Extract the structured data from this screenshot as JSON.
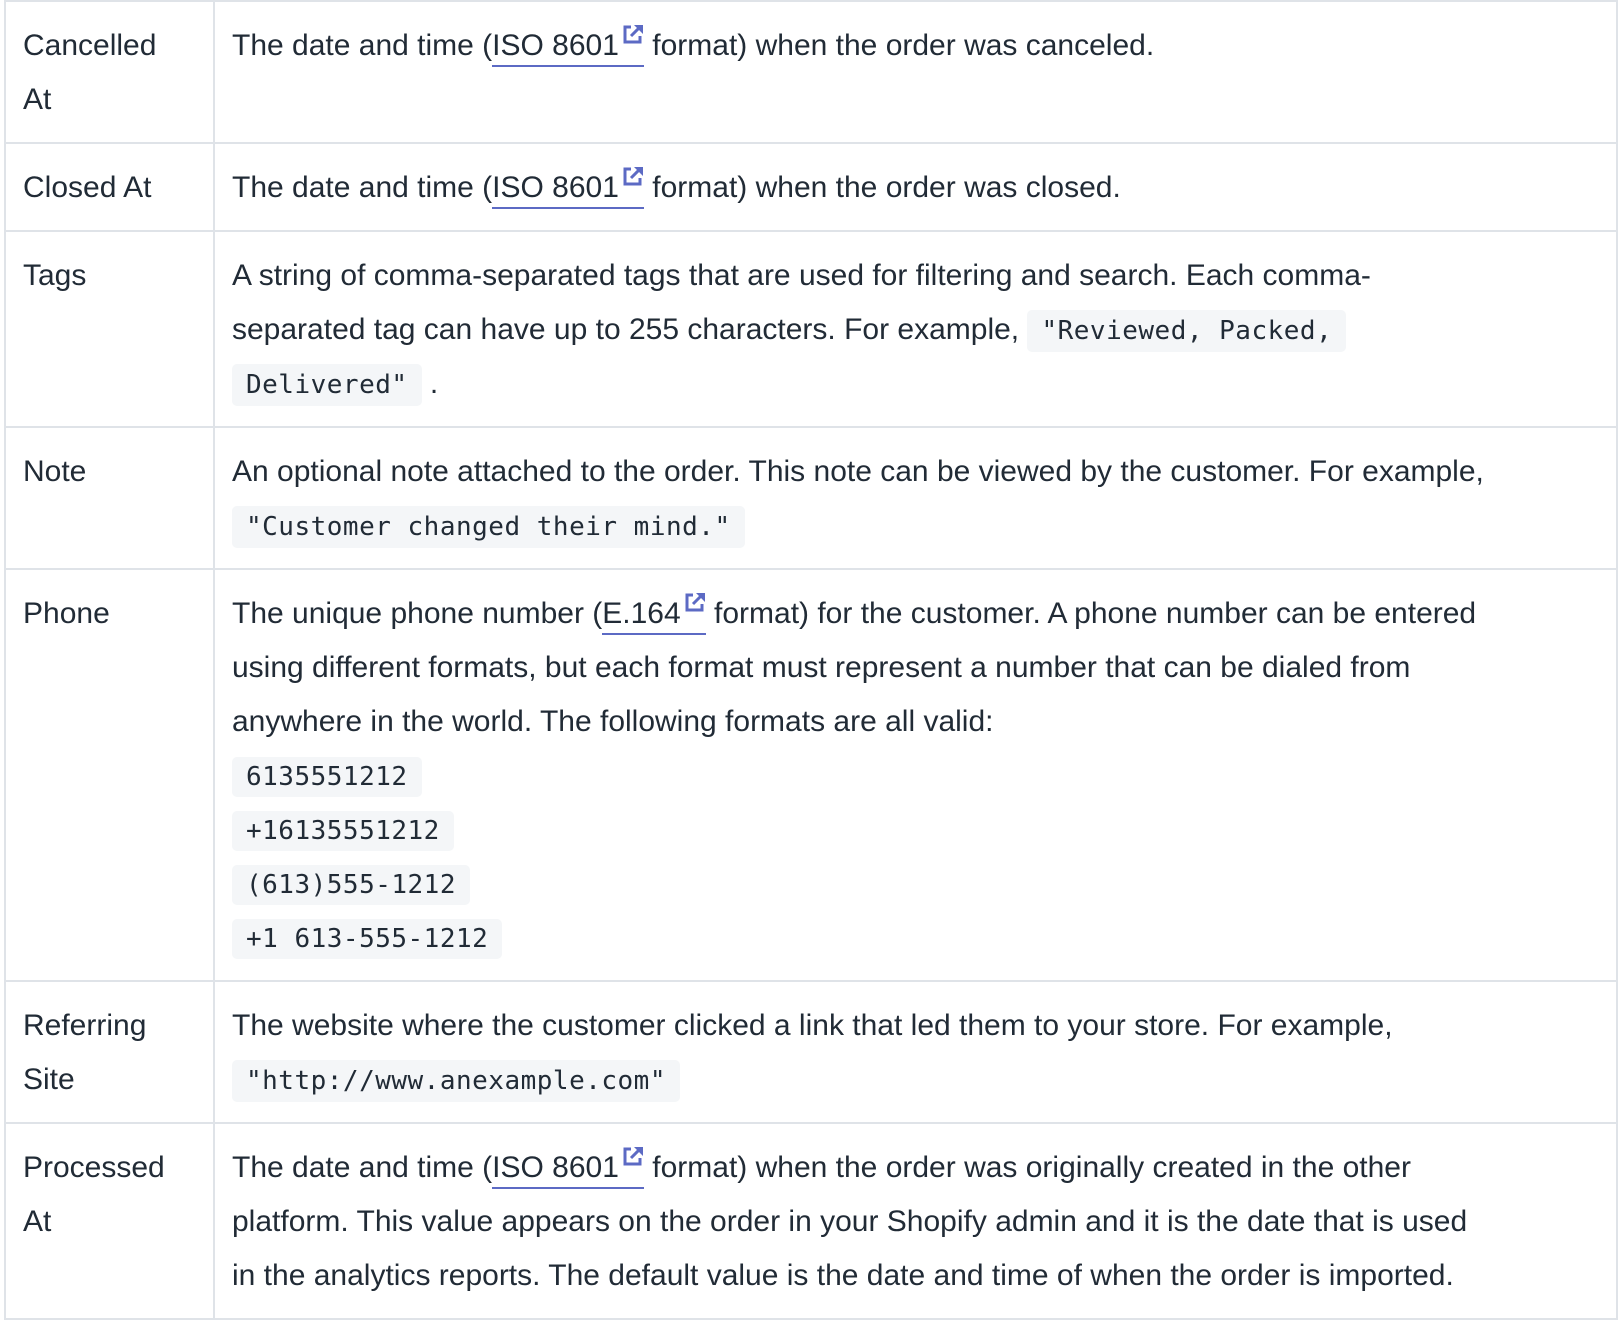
{
  "colors": {
    "text": "#212b36",
    "border": "#dfe3e8",
    "link_underline": "#5c6ac4",
    "code_bg": "#f4f6f8"
  },
  "rows": [
    {
      "name_lines": [
        "Cancelled",
        "At"
      ],
      "desc_lines": [
        [
          {
            "t": "text",
            "v": "The date and time ("
          },
          {
            "t": "link",
            "v": "ISO 8601",
            "icon": "external-link-icon"
          },
          {
            "t": "text",
            "v": " format) when the order was canceled."
          }
        ]
      ]
    },
    {
      "name_lines": [
        "Closed At"
      ],
      "desc_lines": [
        [
          {
            "t": "text",
            "v": "The date and time ("
          },
          {
            "t": "link",
            "v": "ISO 8601",
            "icon": "external-link-icon"
          },
          {
            "t": "text",
            "v": " format) when the order was closed."
          }
        ]
      ]
    },
    {
      "name_lines": [
        "Tags"
      ],
      "desc_lines": [
        [
          {
            "t": "text",
            "v": "A string of comma-separated tags that are used for filtering and search. Each comma-"
          }
        ],
        [
          {
            "t": "text",
            "v": "separated tag can have up to 255 characters. For example, "
          },
          {
            "t": "code",
            "v": "\"Reviewed, Packed, "
          }
        ],
        [
          {
            "t": "code",
            "v": "Delivered\""
          },
          {
            "t": "text",
            "v": " ."
          }
        ]
      ]
    },
    {
      "name_lines": [
        "Note"
      ],
      "desc_lines": [
        [
          {
            "t": "text",
            "v": "An optional note attached to the order. This note can be viewed by the customer. For example,"
          }
        ],
        [
          {
            "t": "code",
            "v": "\"Customer changed their mind.\""
          }
        ]
      ]
    },
    {
      "name_lines": [
        "Phone"
      ],
      "desc_lines": [
        [
          {
            "t": "text",
            "v": "The unique phone number ("
          },
          {
            "t": "link",
            "v": "E.164",
            "icon": "external-link-icon"
          },
          {
            "t": "text",
            "v": " format) for the customer. A phone number can be entered"
          }
        ],
        [
          {
            "t": "text",
            "v": "using different formats, but each format must represent a number that can be dialed from"
          }
        ],
        [
          {
            "t": "text",
            "v": "anywhere in the world. The following formats are all valid:"
          }
        ]
      ],
      "code_blocks": [
        "6135551212",
        "+16135551212",
        "(613)555-1212",
        "+1 613-555-1212"
      ]
    },
    {
      "name_lines": [
        "Referring",
        "Site"
      ],
      "desc_lines": [
        [
          {
            "t": "text",
            "v": "The website where the customer clicked a link that led them to your store. For example,"
          }
        ],
        [
          {
            "t": "code",
            "v": "\"http://www.anexample.com\""
          }
        ]
      ]
    },
    {
      "name_lines": [
        "Processed",
        "At"
      ],
      "desc_lines": [
        [
          {
            "t": "text",
            "v": "The date and time ("
          },
          {
            "t": "link",
            "v": "ISO 8601",
            "icon": "external-link-icon"
          },
          {
            "t": "text",
            "v": " format) when the order was originally created in the other"
          }
        ],
        [
          {
            "t": "text",
            "v": "platform. This value appears on the order in your Shopify admin and it is the date that is used"
          }
        ],
        [
          {
            "t": "text",
            "v": "in the analytics reports. The default value is the date and time of when the order is imported."
          }
        ]
      ]
    }
  ]
}
